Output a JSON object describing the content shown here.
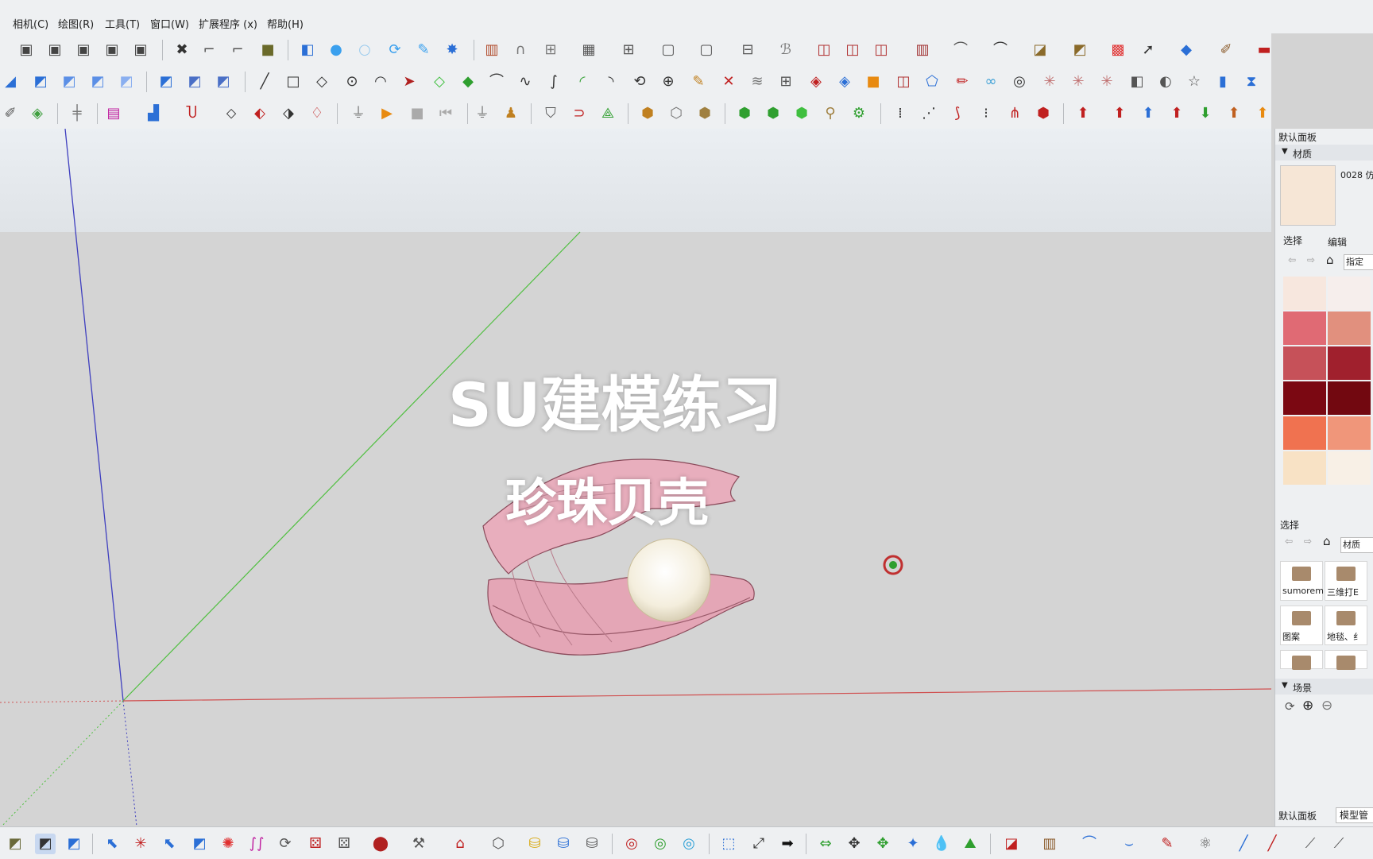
{
  "menu": [
    "相机(C)",
    "绘图(R)",
    "工具(T)",
    "窗口(W)",
    "扩展程序 (x)",
    "帮助(H)"
  ],
  "overlay": {
    "title": "SU建模练习",
    "subtitle": "珍珠贝壳"
  },
  "tray": {
    "title": "默认面板",
    "materials_section": "材质",
    "material_name": "0028 仿",
    "tab_select": "选择",
    "tab_edit": "编辑",
    "dropdown_value": "指定",
    "select_section": "选择",
    "material_dropdown": "材质",
    "folders": [
      "sumorem",
      "三维打E",
      "图案",
      "地毯、纟"
    ],
    "scenes_section": "场景",
    "bottom_tabs": [
      "默认面板",
      "模型管"
    ]
  },
  "swatch_colors": [
    "#f7e7de",
    "#f6eeec",
    "#e06a74",
    "#e1907e",
    "#c65159",
    "#a0202d",
    "#7b0812",
    "#720810",
    "#f07250",
    "#f0967a",
    "#f8e2c5",
    "#f8f0e6"
  ],
  "current_material_color": "#f6e6d6",
  "colors": {
    "accent": "#3aa0ee",
    "axis_red": "#d05050",
    "axis_green": "#4fbf3f",
    "axis_blue": "#3f3fbf",
    "shell_pink": "#e8aebd",
    "pearl": "#f7f2e2"
  }
}
